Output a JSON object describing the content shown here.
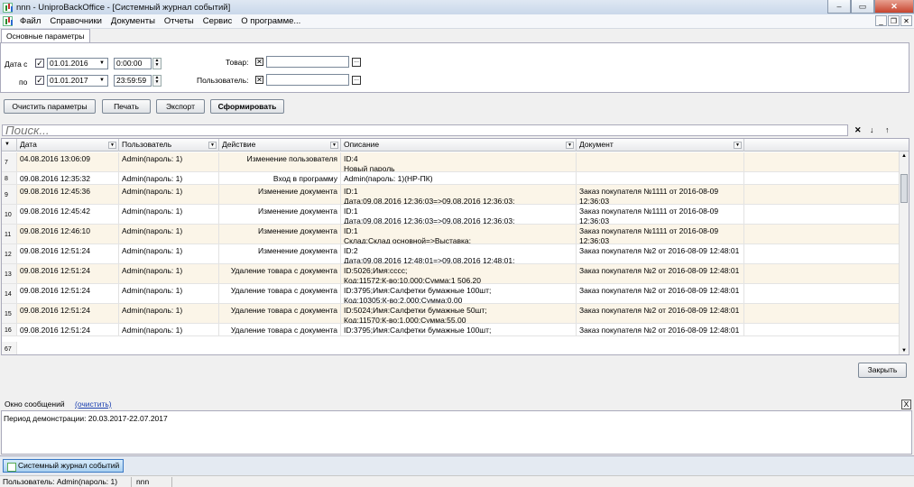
{
  "window": {
    "title": "nnn - UniproBackOffice - [Системный журнал событий]"
  },
  "menu": [
    "Файл",
    "Справочники",
    "Документы",
    "Отчеты",
    "Сервис",
    "О программе..."
  ],
  "tab": "Основные параметры",
  "params": {
    "date_from_label": "Дата с",
    "date_to_label": "по",
    "date_from": "01.01.2016",
    "time_from": "0:00:00",
    "date_to": "01.01.2017",
    "time_to": "23:59:59",
    "product_label": "Товар:",
    "user_label": "Пользователь:"
  },
  "buttons": {
    "clear": "Очистить параметры",
    "print": "Печать",
    "export": "Экспорт",
    "build": "Сформировать",
    "close": "Закрыть"
  },
  "search": {
    "placeholder": "Поиск..."
  },
  "grid": {
    "columns": [
      "Дата",
      "Пользователь",
      "Действие",
      "Описание",
      "Документ"
    ],
    "rows": [
      {
        "n": "7",
        "date": "04.08.2016 13:06:09",
        "user": "Admin(пароль: 1)",
        "action": "Изменение пользователя",
        "desc1": "ID:4",
        "desc2": "Новый пароль",
        "doc1": "",
        "doc2": ""
      },
      {
        "n": "8",
        "date": "09.08.2016 12:35:32",
        "user": "Admin(пароль: 1)",
        "action": "Вход в программу",
        "desc1": "Admin(пароль: 1)(НР-ПК)",
        "desc2": "",
        "doc1": "",
        "doc2": ""
      },
      {
        "n": "9",
        "date": "09.08.2016 12:45:36",
        "user": "Admin(пароль: 1)",
        "action": "Изменение документа",
        "desc1": "ID:1",
        "desc2": "Дата:09.08.2016 12:36:03=>09.08.2016 12:36:03;",
        "doc1": "Заказ покупателя №1111 от 2016-08-09",
        "doc2": "12:36:03"
      },
      {
        "n": "10",
        "date": "09.08.2016 12:45:42",
        "user": "Admin(пароль: 1)",
        "action": "Изменение документа",
        "desc1": "ID:1",
        "desc2": "Дата:09.08.2016 12:36:03=>09.08.2016 12:36:03;",
        "doc1": "Заказ покупателя №1111 от 2016-08-09",
        "doc2": "12:36:03"
      },
      {
        "n": "11",
        "date": "09.08.2016 12:46:10",
        "user": "Admin(пароль: 1)",
        "action": "Изменение документа",
        "desc1": "ID:1",
        "desc2": "Склад:Склад основной=>Выставка;",
        "doc1": "Заказ покупателя №1111 от 2016-08-09",
        "doc2": "12:36:03"
      },
      {
        "n": "12",
        "date": "09.08.2016 12:51:24",
        "user": "Admin(пароль: 1)",
        "action": "Изменение документа",
        "desc1": "ID:2",
        "desc2": "Дата:09.08.2016 12:48:01=>09.08.2016 12:48:01;",
        "doc1": "Заказ покупателя №2 от 2016-08-09 12:48:01",
        "doc2": ""
      },
      {
        "n": "13",
        "date": "09.08.2016 12:51:24",
        "user": "Admin(пароль: 1)",
        "action": "Удаление товара с документа",
        "desc1": "ID:5026;Имя:cccc;",
        "desc2": "Код:11572;К-во:10.000;Сумма:1 506.20",
        "doc1": "Заказ покупателя №2 от 2016-08-09 12:48:01",
        "doc2": ""
      },
      {
        "n": "14",
        "date": "09.08.2016 12:51:24",
        "user": "Admin(пароль: 1)",
        "action": "Удаление товара с документа",
        "desc1": "ID:3795;Имя:Салфетки бумажные 100шт;",
        "desc2": "Код:10305;К-во:2.000;Сумма:0.00",
        "doc1": "Заказ покупателя №2 от 2016-08-09 12:48:01",
        "doc2": ""
      },
      {
        "n": "15",
        "date": "09.08.2016 12:51:24",
        "user": "Admin(пароль: 1)",
        "action": "Удаление товара с документа",
        "desc1": "ID:5024;Имя:Салфетки бумажные 50шт;",
        "desc2": "Код:11570;К-во:1.000;Сумма:55.00",
        "doc1": "Заказ покупателя №2 от 2016-08-09 12:48:01",
        "doc2": ""
      },
      {
        "n": "16",
        "date": "09.08.2016 12:51:24",
        "user": "Admin(пароль: 1)",
        "action": "Удаление товара с документа",
        "desc1": "ID:3795;Имя:Салфетки бумажные 100шт;",
        "desc2": "",
        "doc1": "Заказ покупателя №2 от 2016-08-09 12:48:01",
        "doc2": ""
      }
    ],
    "footer_count": "67"
  },
  "messages": {
    "title": "Окно сообщений",
    "clear_link": "(очистить)",
    "text": "Период демонстрации: 20.03.2017-22.07.2017",
    "close": "X"
  },
  "taskbar": {
    "item": "Системный журнал событий"
  },
  "status": {
    "user": "Пользователь: Admin(пароль: 1)",
    "base": "nnn"
  }
}
